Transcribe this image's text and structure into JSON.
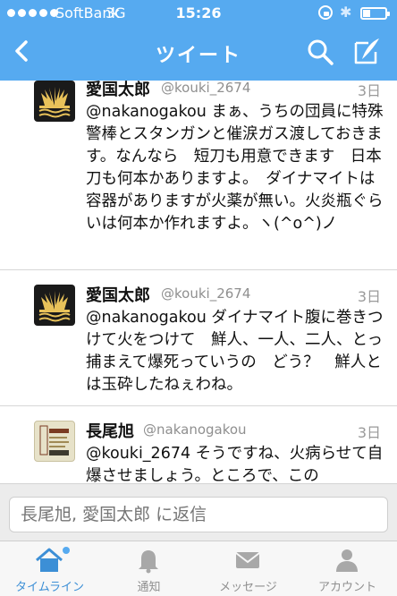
{
  "status_bar": {
    "carrier": "SoftBank",
    "network": "3G",
    "time": "15:26"
  },
  "nav": {
    "title": "ツイート",
    "back_icon": "chevron-left-icon",
    "search_icon": "search-icon",
    "compose_icon": "compose-icon"
  },
  "tweets": [
    {
      "name": "愛国太郎",
      "handle": "@kouki_2674",
      "time": "3日",
      "text": "@nakanogakou まぁ、うちの団員に特殊警棒とスタンガンと催涙ガス渡しておきます。なんなら　短刀も用意できます　日本刀も何本かありますよ。　ダイナマイトは容器がありますが火薬が無い。火炎瓶ぐらいは何本か作れますよ。ヽ(^o^)ノ"
    },
    {
      "name": "愛国太郎",
      "handle": "@kouki_2674",
      "time": "3日",
      "text": "@nakanogakou ダイナマイト腹に巻きつけて火をつけて　鮮人、一人、二人、とっ捕まえて爆死っていうの　どう？　鮮人とは玉砕したねぇわね。"
    },
    {
      "name": "長尾旭",
      "handle": "@nakanogakou",
      "time": "3日",
      "text": "@kouki_2674 そうですね、火病らせて自爆させましょう。ところで、この"
    }
  ],
  "reply": {
    "placeholder": "長尾旭, 愛国太郎 に返信"
  },
  "tabs": [
    {
      "label": "タイムライン",
      "icon": "home-icon",
      "active": true
    },
    {
      "label": "通知",
      "icon": "bell-icon",
      "active": false
    },
    {
      "label": "メッセージ",
      "icon": "envelope-icon",
      "active": false
    },
    {
      "label": "アカウント",
      "icon": "person-icon",
      "active": false
    }
  ],
  "colors": {
    "bar_blue": "#56aaf0",
    "active_tab": "#3c8fd6",
    "muted": "#8f8f8f"
  }
}
